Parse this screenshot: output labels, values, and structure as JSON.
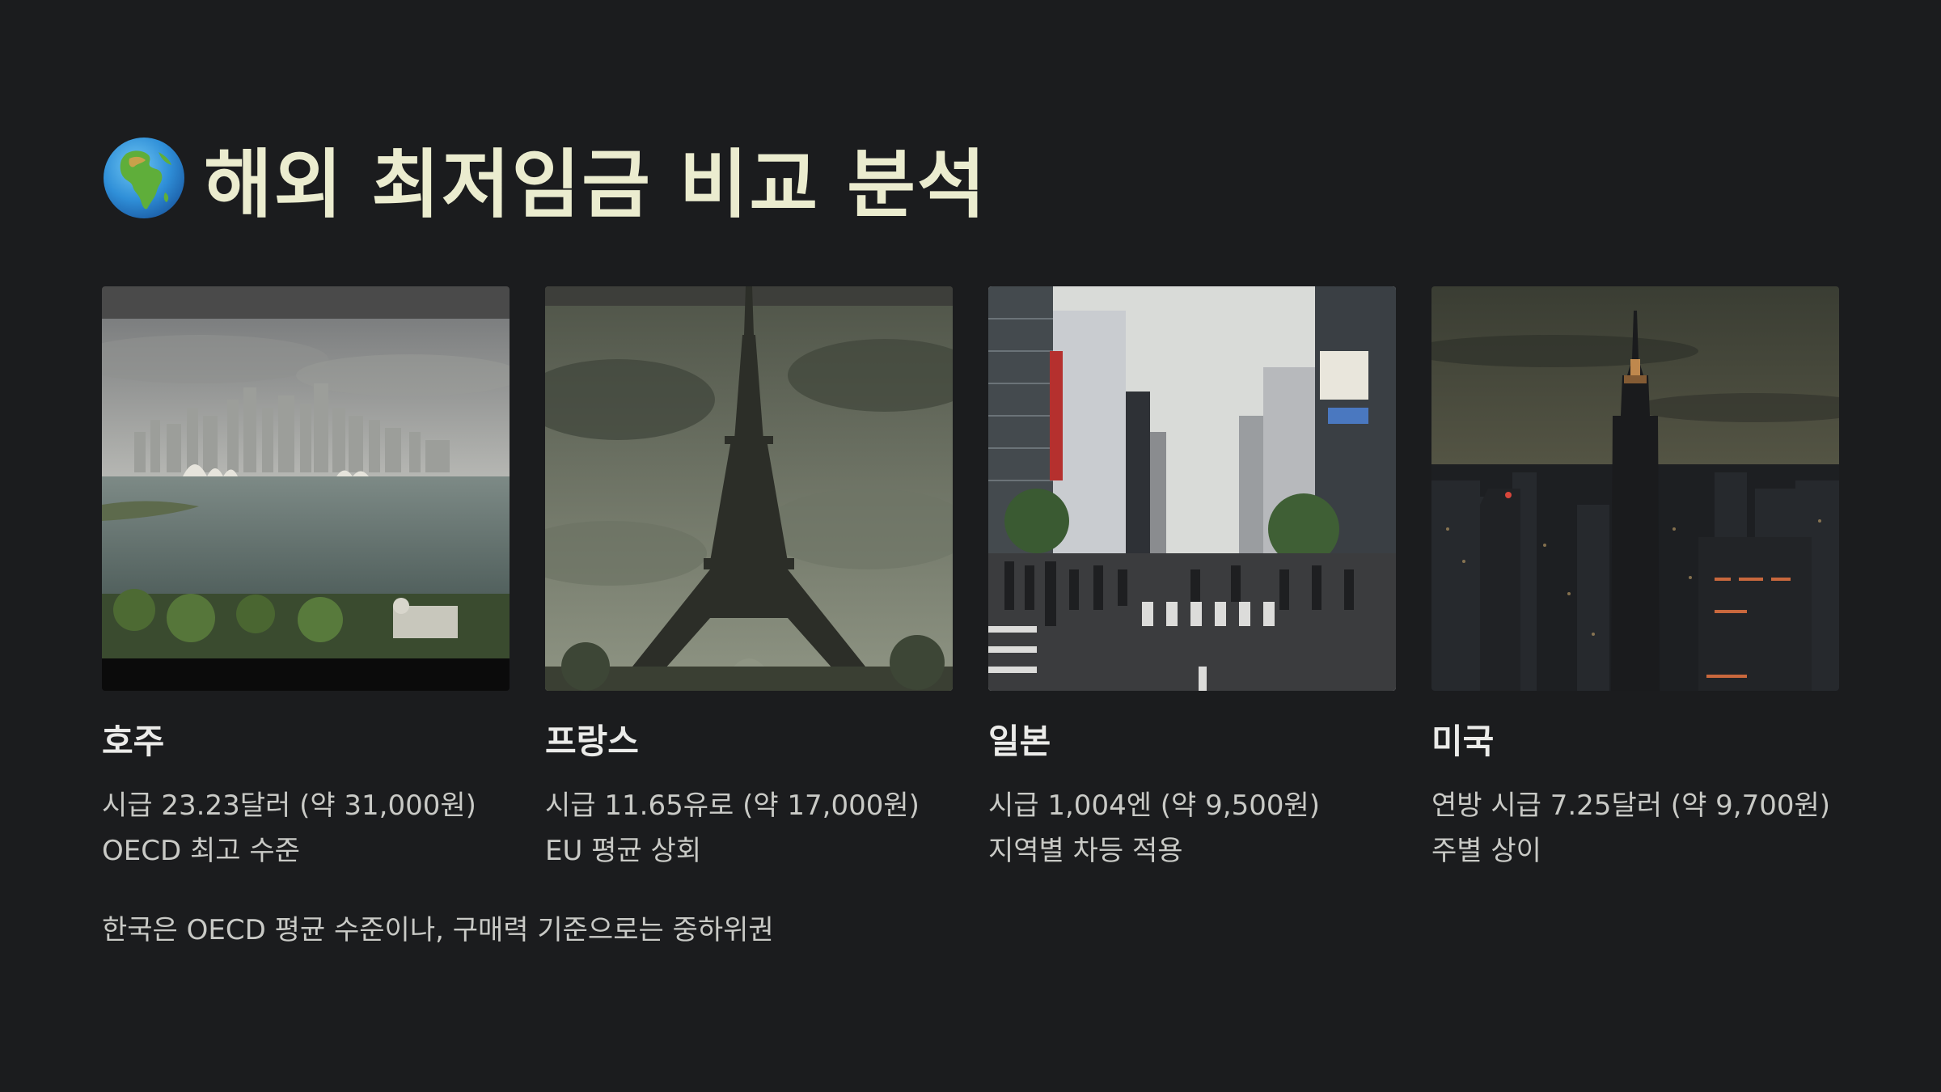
{
  "slide": {
    "title_icon": "globe-africa-icon",
    "title": "해외 최저임금 비교 분석",
    "footnote": "한국은 OECD 평균 수준이나, 구매력 기준으로는 중하위권"
  },
  "cards": [
    {
      "country": "호주",
      "wage": "시급 23.23달러 (약 31,000원)",
      "note": "OECD 최고 수준",
      "photo": "sydney-harbour-skyline-photo"
    },
    {
      "country": "프랑스",
      "wage": "시급 11.65유로 (약 17,000원)",
      "note": "EU 평균 상회",
      "photo": "eiffel-tower-photo"
    },
    {
      "country": "일본",
      "wage": "시급 1,004엔 (약 9,500원)",
      "note": "지역별 차등 적용",
      "photo": "tokyo-street-crossing-photo"
    },
    {
      "country": "미국",
      "wage": "연방 시급 7.25달러 (약 9,700원)",
      "note": "주별 상이",
      "photo": "new-york-night-skyline-photo"
    }
  ],
  "colors": {
    "background": "#1b1c1e",
    "title": "#ebeccf",
    "body_text": "#c9cac6"
  }
}
